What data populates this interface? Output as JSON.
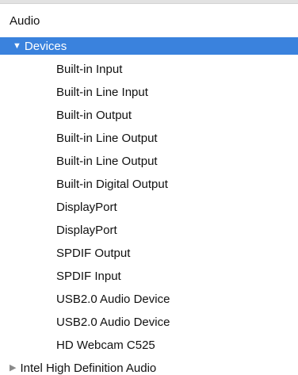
{
  "section": {
    "title": "Audio"
  },
  "devices_group": {
    "label": "Devices",
    "expanded_icon": "disclosure-triangle-down-icon",
    "items": [
      {
        "label": "Built-in Input"
      },
      {
        "label": "Built-in Line Input"
      },
      {
        "label": "Built-in Output"
      },
      {
        "label": "Built-in Line Output"
      },
      {
        "label": "Built-in Line Output"
      },
      {
        "label": "Built-in Digital Output"
      },
      {
        "label": "DisplayPort"
      },
      {
        "label": "DisplayPort"
      },
      {
        "label": "SPDIF Output"
      },
      {
        "label": "SPDIF Input"
      },
      {
        "label": "USB2.0 Audio Device"
      },
      {
        "label": "USB2.0 Audio Device"
      },
      {
        "label": "HD Webcam C525"
      }
    ]
  },
  "collapsed_group": {
    "label": "Intel High Definition Audio",
    "collapsed_icon": "disclosure-triangle-right-icon"
  },
  "colors": {
    "selection": "#3a82dd",
    "text": "#111111",
    "background": "#ffffff"
  }
}
